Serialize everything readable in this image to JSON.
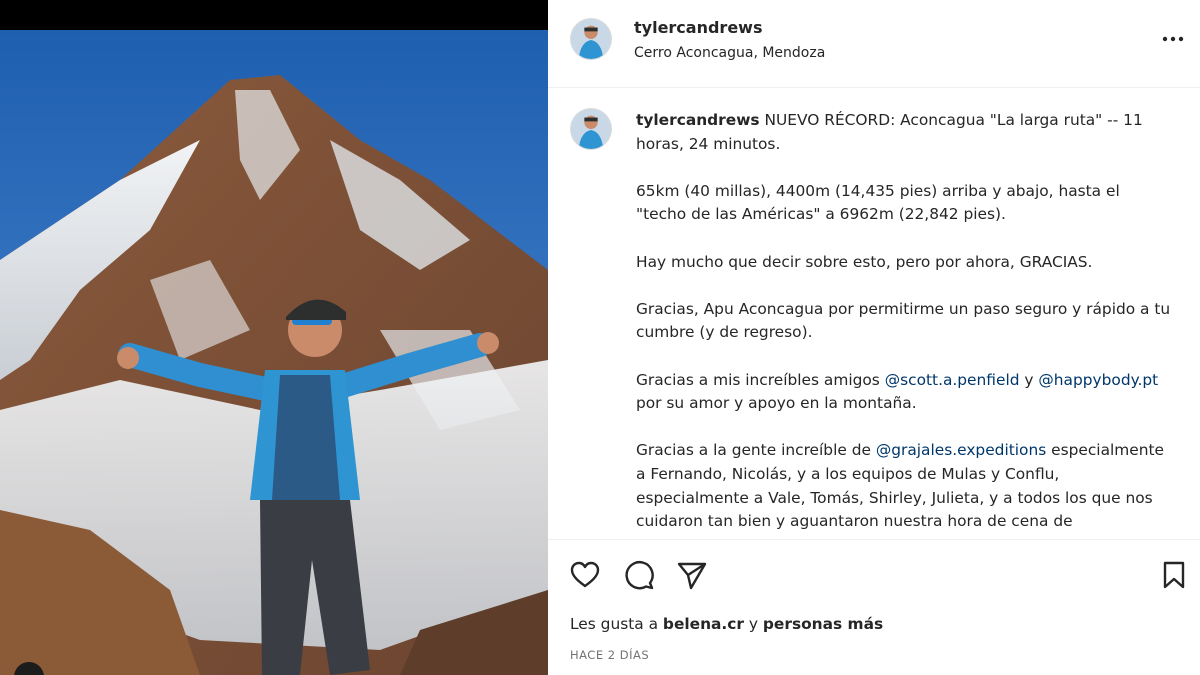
{
  "post": {
    "image_description_icon": "mountain-photo",
    "header": {
      "username": "tylercandrews",
      "location": "Cerro Aconcagua, Mendoza"
    },
    "caption": {
      "username": "tylercandrews",
      "line1": "NUEVO RÉCORD: Aconcagua \"La larga ruta\" -- 11 horas, 24 minutos.",
      "para2": "65km (40 millas), 4400m (14,435 pies) arriba y abajo, hasta el \"techo de las Américas\" a 6962m (22,842 pies).",
      "para3": "Hay mucho que decir sobre esto, pero por ahora, GRACIAS.",
      "para4": "Gracias, Apu Aconcagua por permitirme un paso seguro y rápido a tu cumbre (y de regreso).",
      "para5_pre": "Gracias a mis increíbles amigos ",
      "para5_mention1": "@scott.a.penfield",
      "para5_mid": " y ",
      "para5_mention2": "@happybody.pt",
      "para5_post": " por su amor y apoyo en la montaña.",
      "para6_pre": "Gracias a la gente increíble de ",
      "para6_mention": "@grajales.expeditions",
      "para6_post": " especialmente a Fernando, Nicolás, y a los equipos de Mulas y Conflu, especialmente a Vale, Tomás, Shirley, Julieta, y a todos los que nos cuidaron tan bien y aguantaron nuestra hora de cena de"
    },
    "likes": {
      "prefix": "Les gusta a ",
      "user": "belena.cr",
      "mid": " y ",
      "others": "personas más"
    },
    "timestamp": "HACE 2 DÍAS",
    "icons": {
      "more": "more-options-icon",
      "like": "heart-icon",
      "comment": "comment-bubble-icon",
      "share": "paper-plane-icon",
      "save": "bookmark-icon"
    },
    "colors": {
      "text": "#262626",
      "mention": "#00376b",
      "muted": "#737373",
      "divider": "#efefef"
    }
  }
}
